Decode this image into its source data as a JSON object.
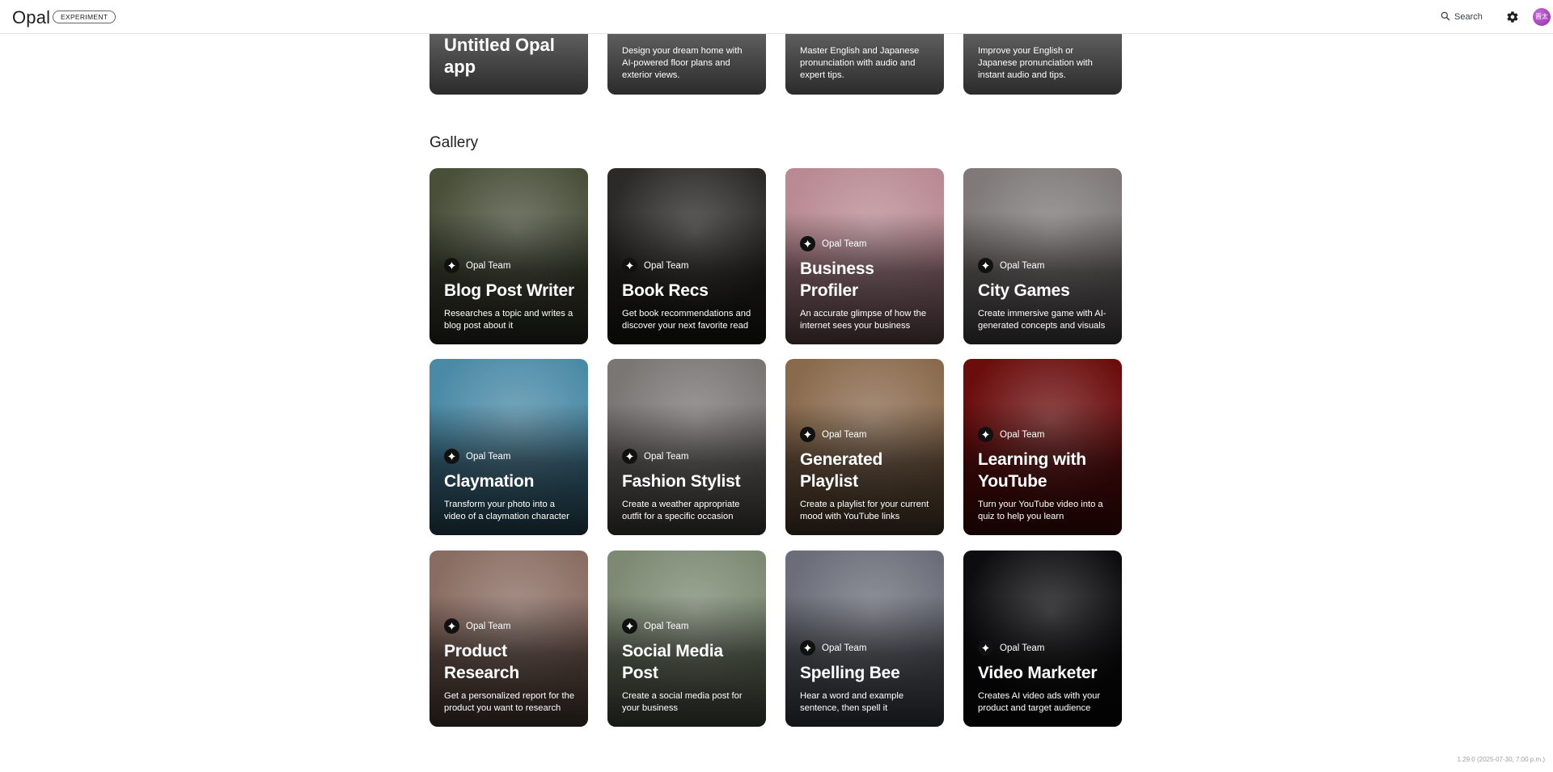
{
  "header": {
    "app_name": "Opal",
    "badge": "EXPERIMENT",
    "search_label": "Search",
    "avatar_initials": "晋太"
  },
  "my_apps": [
    {
      "title": "Untitled Opal app",
      "description": ""
    },
    {
      "title": "",
      "description": "Design your dream home with AI-powered floor plans and exterior views."
    },
    {
      "title": "",
      "description": "Master English and Japanese pronunciation with audio and expert tips."
    },
    {
      "title": "",
      "description": "Improve your English or Japanese pronunciation with instant audio and tips."
    }
  ],
  "gallery": {
    "heading": "Gallery",
    "items": [
      {
        "author": "Opal Team",
        "title": "Blog Post Writer",
        "description": "Researches a topic and writes a blog post about it",
        "bg": "#4a4f3a"
      },
      {
        "author": "Opal Team",
        "title": "Book Recs",
        "description": "Get book recommendations and discover your next favorite read",
        "bg": "#2c2a28"
      },
      {
        "author": "Opal Team",
        "title": "Business Profiler",
        "description": "An accurate glimpse of how the internet sees your business",
        "bg": "#b98a93"
      },
      {
        "author": "Opal Team",
        "title": "City Games",
        "description": "Create immersive game with AI-generated concepts and visuals",
        "bg": "#7f7979"
      },
      {
        "author": "Opal Team",
        "title": "Claymation",
        "description": "Transform your photo into a video of a claymation character",
        "bg": "#4a8aa6"
      },
      {
        "author": "Opal Team",
        "title": "Fashion Stylist",
        "description": "Create a weather appropriate outfit for a specific occasion",
        "bg": "#7a7674"
      },
      {
        "author": "Opal Team",
        "title": "Generated Playlist",
        "description": "Create a playlist for your current mood with YouTube links",
        "bg": "#8a6a4d"
      },
      {
        "author": "Opal Team",
        "title": "Learning with YouTube",
        "description": "Turn your YouTube video into a quiz to help you learn",
        "bg": "#6b0d0d"
      },
      {
        "author": "Opal Team",
        "title": "Product Research",
        "description": "Get a personalized report for the product you want to research",
        "bg": "#8a6d62"
      },
      {
        "author": "Opal Team",
        "title": "Social Media Post",
        "description": "Create a social media post for your business",
        "bg": "#7d8a73"
      },
      {
        "author": "Opal Team",
        "title": "Spelling Bee",
        "description": "Hear a word and example sentence, then spell it",
        "bg": "#6b6e79"
      },
      {
        "author": "Opal Team",
        "title": "Video Marketer",
        "description": "Creates AI video ads with your product and target audience",
        "bg": "#0d0d10"
      }
    ]
  },
  "footer": {
    "version": "1.29.0 (2025-07-30, 7:00 p.m.)"
  }
}
